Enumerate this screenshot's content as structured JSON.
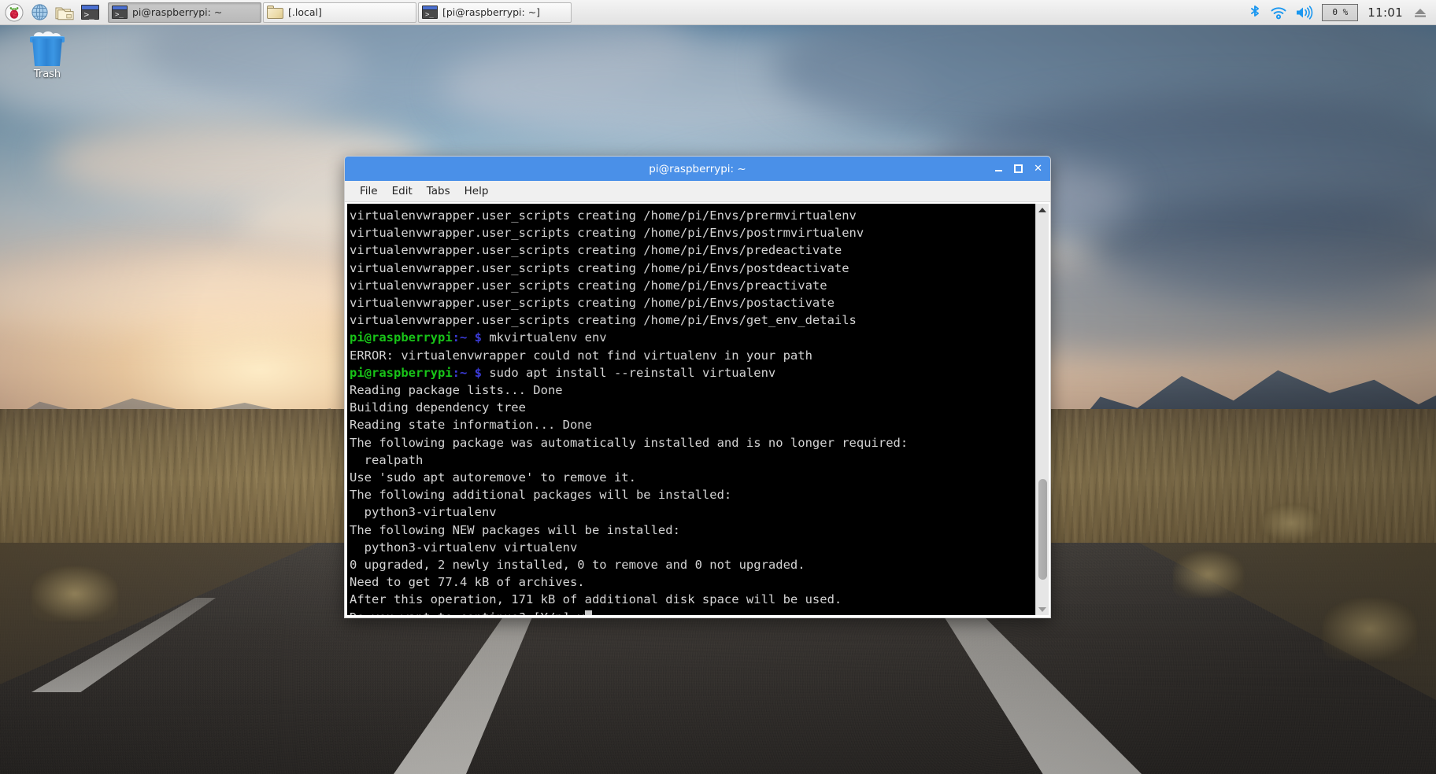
{
  "taskbar": {
    "launchers": [
      {
        "name": "raspberry-menu",
        "label": "Menu"
      },
      {
        "name": "web-browser",
        "label": "Web Browser"
      },
      {
        "name": "file-manager",
        "label": "File Manager"
      },
      {
        "name": "terminal",
        "label": "Terminal"
      }
    ],
    "tasks": [
      {
        "label": "pi@raspberrypi: ~",
        "icon": "terminal-icon",
        "active": true
      },
      {
        "label": "[.local]",
        "icon": "folder-icon",
        "active": false
      },
      {
        "label": "[pi@raspberrypi: ~]",
        "icon": "terminal-icon",
        "active": false
      }
    ],
    "tray": {
      "bluetooth": "bluetooth-icon",
      "wifi": "wifi-icon",
      "volume": "volume-icon",
      "cpu_label": "0 %",
      "clock": "11:01",
      "eject": "eject-icon"
    }
  },
  "desktop": {
    "icons": [
      {
        "name": "trash",
        "label": "Trash"
      }
    ]
  },
  "terminal": {
    "title": "pi@raspberrypi: ~",
    "menu": [
      "File",
      "Edit",
      "Tabs",
      "Help"
    ],
    "window_controls": {
      "minimize": "_",
      "maximize": "□",
      "close": "✕"
    },
    "lines": [
      {
        "type": "out",
        "text": "virtualenvwrapper.user_scripts creating /home/pi/Envs/prermvirtualenv"
      },
      {
        "type": "out",
        "text": "virtualenvwrapper.user_scripts creating /home/pi/Envs/postrmvirtualenv"
      },
      {
        "type": "out",
        "text": "virtualenvwrapper.user_scripts creating /home/pi/Envs/predeactivate"
      },
      {
        "type": "out",
        "text": "virtualenvwrapper.user_scripts creating /home/pi/Envs/postdeactivate"
      },
      {
        "type": "out",
        "text": "virtualenvwrapper.user_scripts creating /home/pi/Envs/preactivate"
      },
      {
        "type": "out",
        "text": "virtualenvwrapper.user_scripts creating /home/pi/Envs/postactivate"
      },
      {
        "type": "out",
        "text": "virtualenvwrapper.user_scripts creating /home/pi/Envs/get_env_details"
      },
      {
        "type": "prompt",
        "user": "pi@raspberrypi",
        "path": ":~",
        "sigil": "$",
        "command": "mkvirtualenv env"
      },
      {
        "type": "out",
        "text": "ERROR: virtualenvwrapper could not find virtualenv in your path"
      },
      {
        "type": "prompt",
        "user": "pi@raspberrypi",
        "path": ":~",
        "sigil": "$",
        "command": "sudo apt install --reinstall virtualenv"
      },
      {
        "type": "out",
        "text": "Reading package lists... Done"
      },
      {
        "type": "out",
        "text": "Building dependency tree"
      },
      {
        "type": "out",
        "text": "Reading state information... Done"
      },
      {
        "type": "out",
        "text": "The following package was automatically installed and is no longer required:"
      },
      {
        "type": "out",
        "text": "  realpath"
      },
      {
        "type": "out",
        "text": "Use 'sudo apt autoremove' to remove it."
      },
      {
        "type": "out",
        "text": "The following additional packages will be installed:"
      },
      {
        "type": "out",
        "text": "  python3-virtualenv"
      },
      {
        "type": "out",
        "text": "The following NEW packages will be installed:"
      },
      {
        "type": "out",
        "text": "  python3-virtualenv virtualenv"
      },
      {
        "type": "out",
        "text": "0 upgraded, 2 newly installed, 0 to remove and 0 not upgraded."
      },
      {
        "type": "out",
        "text": "Need to get 77.4 kB of archives."
      },
      {
        "type": "out",
        "text": "After this operation, 171 kB of additional disk space will be used."
      },
      {
        "type": "input",
        "text": "Do you want to continue? [Y/n] y",
        "cursor": true
      }
    ],
    "colors": {
      "titlebar": "#4a90e8",
      "background": "#000000",
      "foreground": "#d4d4d4",
      "prompt_user": "#18c418",
      "prompt_path": "#3b3bd6"
    }
  }
}
